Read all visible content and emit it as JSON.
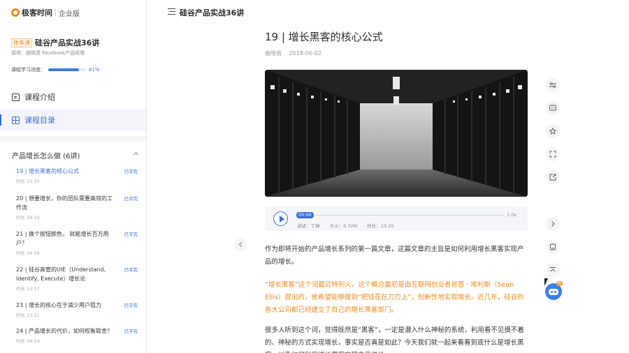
{
  "sidebar": {
    "logo_name": "极客时间",
    "logo_edition": "企业版",
    "course_tag": "体系课",
    "course_title": "硅谷产品实战36讲",
    "course_teacher": "讲师：曲晓音 Facebook产品经理",
    "progress_label": "课程学习进度：",
    "progress_value": "81%",
    "progress_fraction": 0.81,
    "nav": [
      {
        "label": "课程介绍",
        "icon": "doc-icon"
      },
      {
        "label": "课程目录",
        "icon": "catalog-icon",
        "active": true
      }
    ],
    "chapter_title": "产品增长怎么做 (6讲)",
    "lessons": [
      {
        "title": "19 | 增长黑客的核心公式",
        "meta": "时长 13:20",
        "status": "已学完",
        "current": true
      },
      {
        "title": "20 | 想要增长，你的团队需要高效的工作流",
        "meta": "时长 09:16",
        "status": "已学完"
      },
      {
        "title": "21 | 换个按钮颜色， 就能增长百万用户？",
        "meta": "时长 09:56",
        "status": "已学完"
      },
      {
        "title": "22 | 硅谷高管的UIE（Understand, Identify, Execute）增长论",
        "meta": "时长 13:17",
        "status": "已学完"
      },
      {
        "title": "23 | 增长的核心在于减少用户阻力",
        "meta": "时长 13:21",
        "status": "已学完"
      },
      {
        "title": "24 | 产品增长的代价，如何权衡取舍?",
        "meta": "时长 09:54",
        "status": "已学完"
      }
    ]
  },
  "topbar": {
    "title": "硅谷产品实战36讲"
  },
  "article": {
    "title": "19 | 增长黑客的核心公式",
    "author": "曲晓音",
    "date": "2018-06-02",
    "audio": {
      "current_time": "00:00",
      "speed": "1.0x",
      "narrator": "讲述：丁婵",
      "size": "大小：6.32M",
      "duration": "时长：13:20"
    },
    "paragraphs": [
      {
        "text": "作为即将开始的产品增长系列的第一篇文章，这篇文章的主旨是如何利用增长黑客实现产品的增长。",
        "highlight": false
      },
      {
        "text": "“增长黑客”这个词最近特别火，这个概念最初是由互联网创业者肖恩 · 埃利斯（Sean Ellis）提出的，他希望能够做到“把钱花在刀刃上”，创新性地实现增长。近几年，硅谷的各大公司都已经建立了自己的增长黑客部门。",
        "highlight": true
      },
      {
        "text": "很多人听到这个词，觉得既然是“黑客”，一定是潜入什么神秘的系统，利用看不见摸不着的、神秘的方式实现增长，事实是否真是如此？今天我们就一起来看看到底什么是增长黑客，以及如何利用增长黑客实现产品增长。",
        "highlight": false
      }
    ]
  },
  "rail": {
    "icons": [
      "settings-icon",
      "comment-icon",
      "star-icon",
      "fullscreen-icon",
      "share-icon",
      "next-icon",
      "bookmark-icon",
      "back-to-top-icon"
    ],
    "bot_badge": "AI"
  },
  "colors": {
    "accent": "#3b6fd8",
    "brand": "#fa8919",
    "highlight_text": "#f08b1d"
  }
}
